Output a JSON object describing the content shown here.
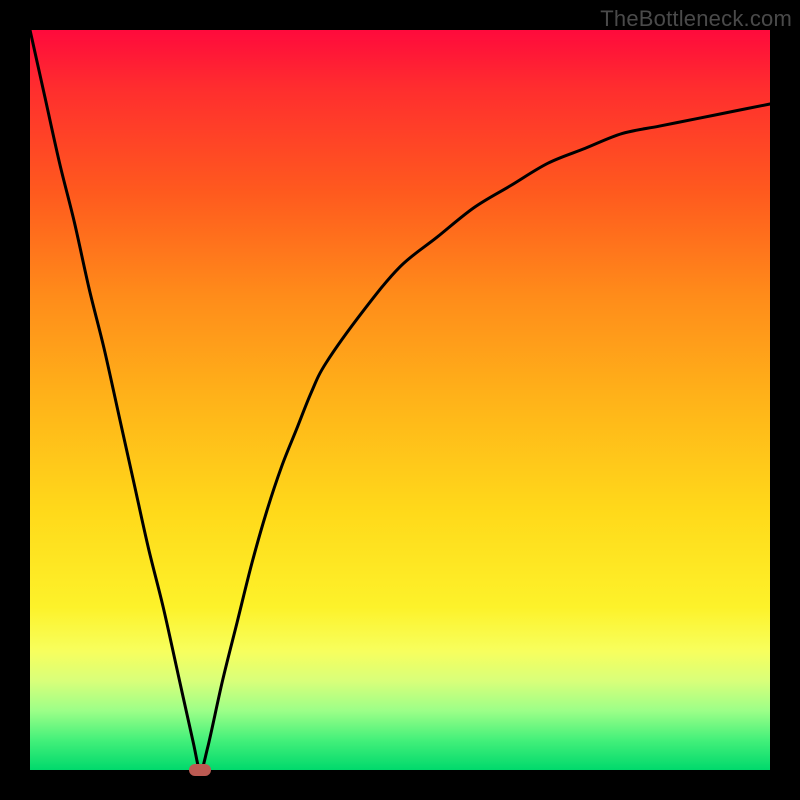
{
  "watermark": "TheBottleneck.com",
  "colors": {
    "frame": "#000000",
    "curve": "#000000",
    "marker": "#bb5a52",
    "gradient_top": "#ff0a3c",
    "gradient_bottom": "#00d96c"
  },
  "chart_data": {
    "type": "line",
    "title": "",
    "xlabel": "",
    "ylabel": "",
    "xlim": [
      0,
      100
    ],
    "ylim": [
      0,
      100
    ],
    "x": [
      0,
      2,
      4,
      6,
      8,
      10,
      12,
      14,
      16,
      18,
      20,
      22,
      23,
      24,
      26,
      28,
      30,
      32,
      34,
      36,
      38,
      40,
      45,
      50,
      55,
      60,
      65,
      70,
      75,
      80,
      85,
      90,
      95,
      100
    ],
    "values": [
      100,
      91,
      82,
      74,
      65,
      57,
      48,
      39,
      30,
      22,
      13,
      4,
      0,
      3,
      12,
      20,
      28,
      35,
      41,
      46,
      51,
      55,
      62,
      68,
      72,
      76,
      79,
      82,
      84,
      86,
      87,
      88,
      89,
      90
    ],
    "marker": {
      "x": 23,
      "y": 0
    },
    "grid": false,
    "legend": false
  }
}
